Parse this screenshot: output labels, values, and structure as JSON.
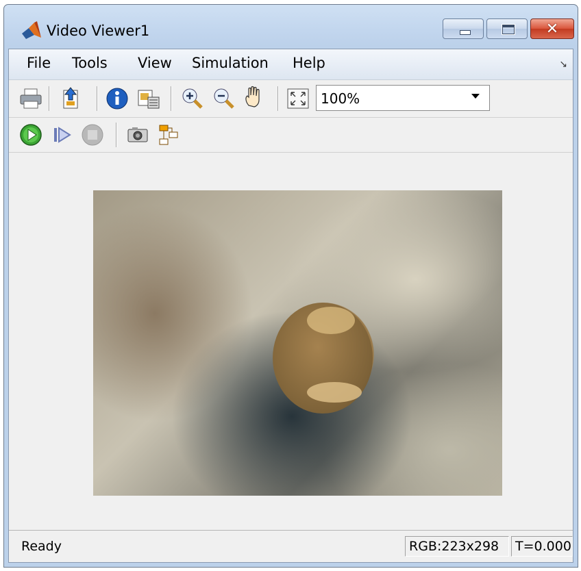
{
  "window": {
    "title": "Video Viewer1",
    "icon": "matlab-icon",
    "controls": [
      "minimize-icon",
      "maximize-icon",
      "close-icon"
    ]
  },
  "menubar": {
    "items": [
      {
        "label": "File"
      },
      {
        "label": "Tools"
      },
      {
        "label": "View"
      },
      {
        "label": "Simulation"
      },
      {
        "label": "Help"
      }
    ],
    "corner_glyph": "↘"
  },
  "toolbar1": {
    "tools": [
      "print-icon",
      "export-icon",
      "info-icon",
      "image-properties-icon",
      "zoom-in-icon",
      "zoom-out-icon",
      "pan-hand-icon",
      "fit-to-view-icon"
    ],
    "zoom": {
      "value": "100%"
    }
  },
  "toolbar2": {
    "tools": [
      "play-icon",
      "step-forward-icon",
      "stop-icon",
      "snapshot-icon",
      "highlight-block-icon"
    ]
  },
  "video": {
    "description_icon": "video-frame"
  },
  "statusbar": {
    "status": "Ready",
    "dimensions": "RGB:223x298",
    "time": "T=0.000"
  },
  "colors": {
    "titlebar": "#c2d6ee",
    "close_button": "#c23b21",
    "play_green": "#3ba534",
    "client_bg": "#f0f0f0"
  }
}
